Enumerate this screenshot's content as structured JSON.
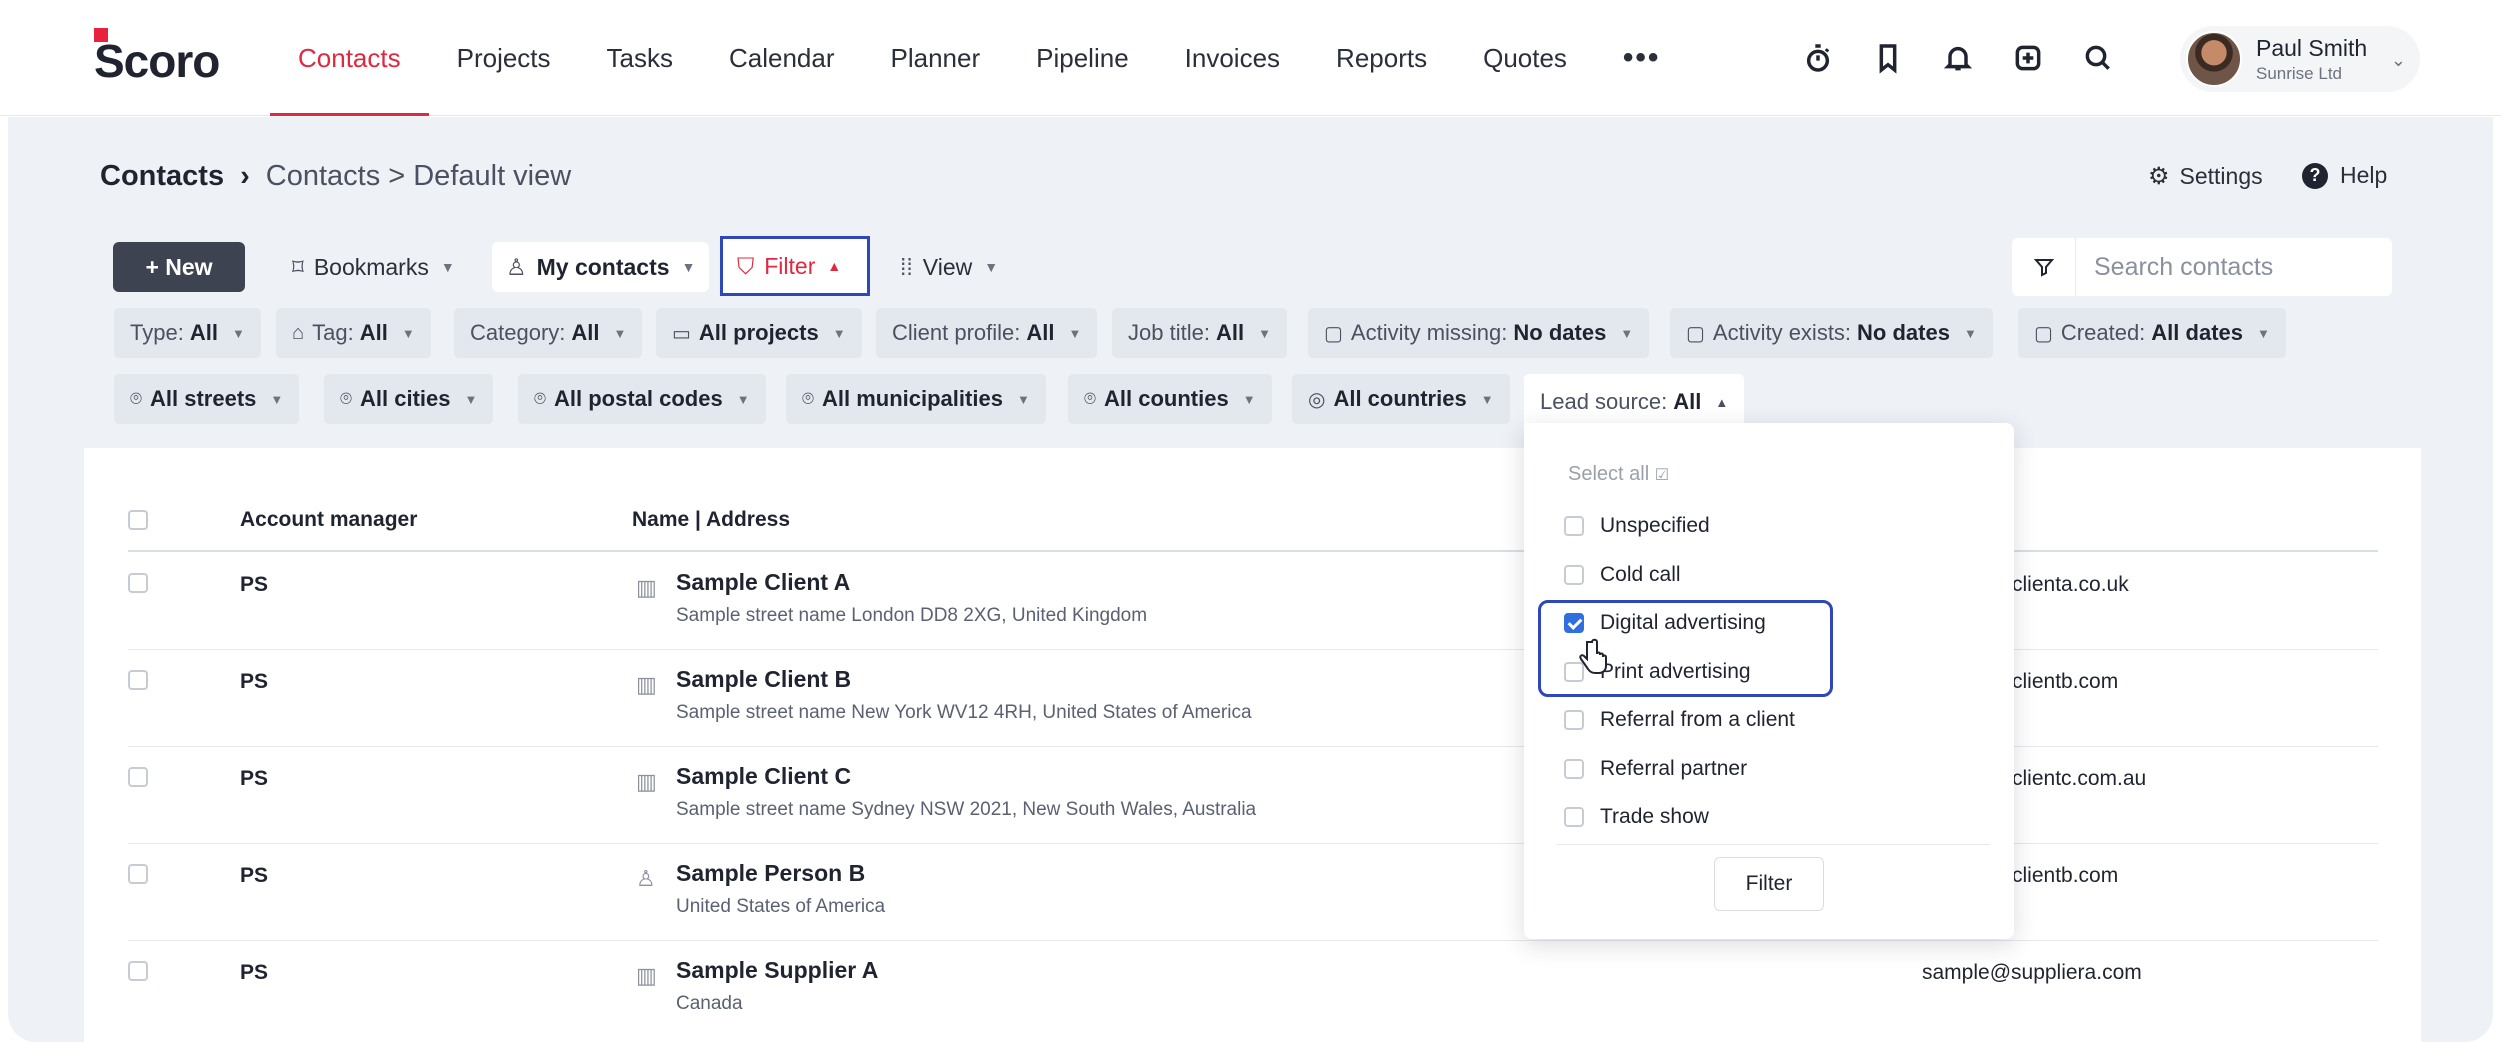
{
  "app": {
    "logo": "Scoro",
    "nav": [
      "Contacts",
      "Projects",
      "Tasks",
      "Calendar",
      "Planner",
      "Pipeline",
      "Invoices",
      "Reports",
      "Quotes"
    ],
    "nav_more": "•••",
    "user": {
      "name": "Paul Smith",
      "org": "Sunrise Ltd"
    }
  },
  "header": {
    "title": "Contacts",
    "separator": "›",
    "path": "Contacts > Default view",
    "settings": "Settings",
    "help": "Help"
  },
  "toolbar": {
    "new": "+ New",
    "bookmarks": "Bookmarks",
    "my_contacts": "My contacts",
    "filter": "Filter",
    "view": "View",
    "search_placeholder": "Search contacts"
  },
  "filters_row1": [
    {
      "label": "Type:",
      "value": "All"
    },
    {
      "label": "Tag:",
      "value": "All"
    },
    {
      "label": "Category:",
      "value": "All"
    },
    {
      "label": "",
      "value": "All projects"
    },
    {
      "label": "Client profile:",
      "value": "All"
    },
    {
      "label": "Job title:",
      "value": "All"
    },
    {
      "label": "Activity missing:",
      "value": "No dates"
    },
    {
      "label": "Activity exists:",
      "value": "No dates"
    },
    {
      "label": "Created:",
      "value": "All dates"
    }
  ],
  "filters_row2": [
    {
      "label": "",
      "value": "All streets"
    },
    {
      "label": "",
      "value": "All cities"
    },
    {
      "label": "",
      "value": "All postal codes"
    },
    {
      "label": "",
      "value": "All municipalities"
    },
    {
      "label": "",
      "value": "All counties"
    },
    {
      "label": "",
      "value": "All countries"
    },
    {
      "label": "Lead source:",
      "value": "All"
    }
  ],
  "table": {
    "headers": [
      "Account manager",
      "Name | Address"
    ],
    "rows": [
      {
        "manager": "PS",
        "name": "Sample Client A",
        "address": "Sample street name London DD8 2XG, United Kingdom",
        "email": "clienta.co.uk",
        "kind": "company"
      },
      {
        "manager": "PS",
        "name": "Sample Client B",
        "address": "Sample street name New York WV12 4RH, United States of America",
        "email": "clientb.com",
        "kind": "company"
      },
      {
        "manager": "PS",
        "name": "Sample Client C",
        "address": "Sample street name Sydney NSW 2021, New South Wales, Australia",
        "email": "clientc.com.au",
        "kind": "company"
      },
      {
        "manager": "PS",
        "name": "Sample Person B",
        "address": "United States of America",
        "email": "clientb.com",
        "kind": "person"
      },
      {
        "manager": "PS",
        "name": "Sample Supplier A",
        "address": "Canada",
        "email": "sample@suppliera.com",
        "kind": "company"
      }
    ]
  },
  "lead_source_dropdown": {
    "select_all": "Select all",
    "options": [
      {
        "label": "Unspecified",
        "checked": false
      },
      {
        "label": "Cold call",
        "checked": false
      },
      {
        "label": "Digital advertising",
        "checked": true
      },
      {
        "label": "Print advertising",
        "checked": false
      },
      {
        "label": "Referral from a client",
        "checked": false
      },
      {
        "label": "Referral partner",
        "checked": false
      },
      {
        "label": "Trade show",
        "checked": false
      }
    ],
    "button": "Filter"
  },
  "colors": {
    "accent": "#e0283f",
    "highlight": "#2f47b8",
    "checkbox": "#2f6fe0"
  }
}
